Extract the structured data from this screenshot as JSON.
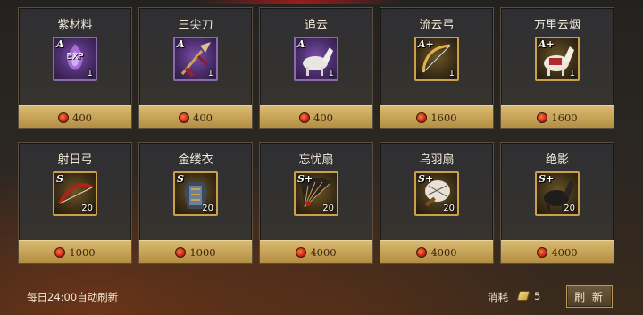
{
  "shop": {
    "rows": [
      [
        {
          "name": "紫材料",
          "grade": "A",
          "qty": "1",
          "price": "400",
          "icon": "exp-crystal-icon",
          "icon_text": "EXP",
          "frame": "purple"
        },
        {
          "name": "三尖刀",
          "grade": "A",
          "qty": "1",
          "price": "400",
          "icon": "trident-blade-icon",
          "frame": "purple"
        },
        {
          "name": "追云",
          "grade": "A",
          "qty": "1",
          "price": "400",
          "icon": "white-horse-icon",
          "frame": "purple"
        },
        {
          "name": "流云弓",
          "grade": "A+",
          "qty": "1",
          "price": "1600",
          "icon": "bow-icon",
          "frame": "gold"
        },
        {
          "name": "万里云烟",
          "grade": "A+",
          "qty": "1",
          "price": "1600",
          "icon": "armored-horse-icon",
          "frame": "gold"
        }
      ],
      [
        {
          "name": "射日弓",
          "grade": "S",
          "qty": "20",
          "price": "1000",
          "icon": "red-bow-icon",
          "frame": "gold"
        },
        {
          "name": "金缕衣",
          "grade": "S",
          "qty": "20",
          "price": "1000",
          "icon": "gold-armor-icon",
          "frame": "gold"
        },
        {
          "name": "忘忧扇",
          "grade": "S+",
          "qty": "20",
          "price": "4000",
          "icon": "fan-icon",
          "frame": "gold"
        },
        {
          "name": "乌羽扇",
          "grade": "S+",
          "qty": "20",
          "price": "4000",
          "icon": "feather-fan-icon",
          "frame": "gold"
        },
        {
          "name": "绝影",
          "grade": "S+",
          "qty": "20",
          "price": "4000",
          "icon": "black-horse-icon",
          "frame": "gold"
        }
      ]
    ]
  },
  "footer": {
    "refresh_note": "每日24:00自动刷新",
    "cost_label": "消耗",
    "cost_value": "5",
    "refresh_button": "刷 新"
  },
  "colors": {
    "price_bar": "#c6a458",
    "coin": "#c8241a",
    "accent_red": "#9a1c1c"
  }
}
